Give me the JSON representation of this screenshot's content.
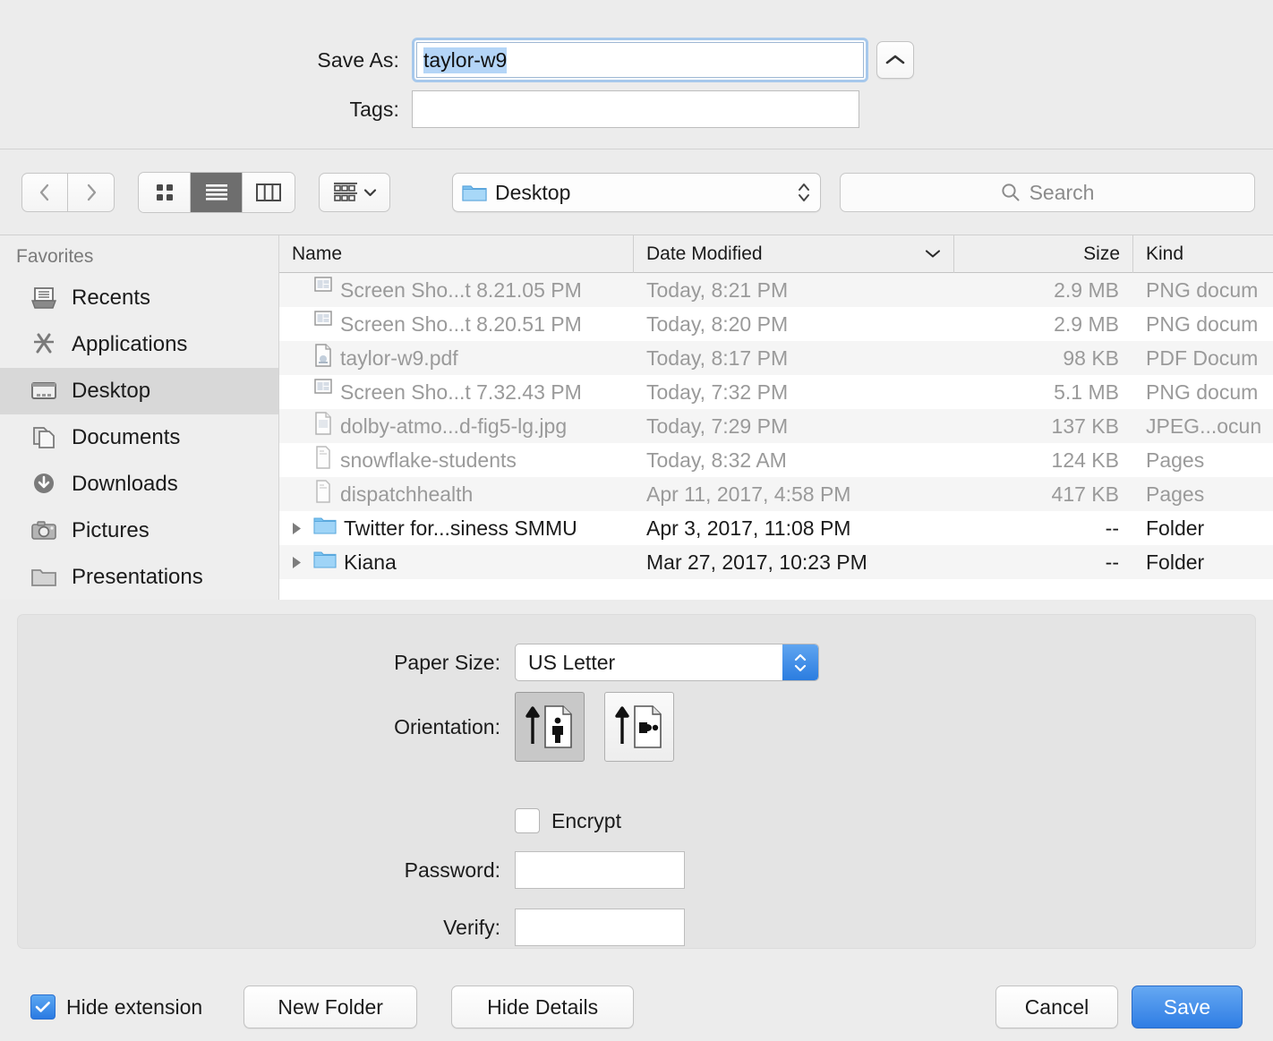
{
  "save_panel": {
    "save_as_label": "Save As:",
    "save_as_value": "taylor-w9",
    "tags_label": "Tags:",
    "tags_value": "",
    "tags_placeholder": "",
    "collapse_icon": "chevron-up-icon"
  },
  "toolbar": {
    "back_icon": "chevron-left-icon",
    "forward_icon": "chevron-right-icon",
    "view_modes": [
      {
        "name": "icon-view",
        "icon": "grid-icon",
        "selected": false
      },
      {
        "name": "list-view",
        "icon": "list-icon",
        "selected": true
      },
      {
        "name": "column-view",
        "icon": "columns-icon",
        "selected": false
      }
    ],
    "arrange_icon": "arrange-icon",
    "arrange_chevron": "chevron-down-icon",
    "path_popup": {
      "icon": "folder-icon",
      "label": "Desktop",
      "stepper_icon": "updown-chevrons-icon"
    },
    "search": {
      "icon": "search-icon",
      "placeholder": "Search",
      "value": ""
    }
  },
  "sidebar": {
    "header": "Favorites",
    "items": [
      {
        "label": "Recents",
        "icon": "recents-icon",
        "selected": false
      },
      {
        "label": "Applications",
        "icon": "applications-icon",
        "selected": false
      },
      {
        "label": "Desktop",
        "icon": "desktop-icon",
        "selected": true
      },
      {
        "label": "Documents",
        "icon": "documents-icon",
        "selected": false
      },
      {
        "label": "Downloads",
        "icon": "downloads-icon",
        "selected": false
      },
      {
        "label": "Pictures",
        "icon": "pictures-icon",
        "selected": false
      },
      {
        "label": "Presentations",
        "icon": "folder-icon",
        "selected": false
      }
    ]
  },
  "file_list": {
    "columns": [
      {
        "label": "Name",
        "sorted": false
      },
      {
        "label": "Date Modified",
        "sorted": true,
        "sort_icon": "chevron-down-icon"
      },
      {
        "label": "Size",
        "sorted": false
      },
      {
        "label": "Kind",
        "sorted": false
      }
    ],
    "rows": [
      {
        "name": "Screen Sho...t 8.21.05 PM",
        "date": "Today, 8:21 PM",
        "size": "2.9 MB",
        "kind": "PNG docum",
        "icon": "png-file-icon",
        "enabled": false,
        "expandable": false
      },
      {
        "name": "Screen Sho...t 8.20.51 PM",
        "date": "Today, 8:20 PM",
        "size": "2.9 MB",
        "kind": "PNG docum",
        "icon": "png-file-icon",
        "enabled": false,
        "expandable": false
      },
      {
        "name": "taylor-w9.pdf",
        "date": "Today, 8:17 PM",
        "size": "98 KB",
        "kind": "PDF Docum",
        "icon": "pdf-file-icon",
        "enabled": false,
        "expandable": false
      },
      {
        "name": "Screen Sho...t 7.32.43 PM",
        "date": "Today, 7:32 PM",
        "size": "5.1 MB",
        "kind": "PNG docum",
        "icon": "png-file-icon",
        "enabled": false,
        "expandable": false
      },
      {
        "name": "dolby-atmo...d-fig5-lg.jpg",
        "date": "Today, 7:29 PM",
        "size": "137 KB",
        "kind": "JPEG...ocun",
        "icon": "jpeg-file-icon",
        "enabled": false,
        "expandable": false
      },
      {
        "name": "snowflake-students",
        "date": "Today, 8:32 AM",
        "size": "124 KB",
        "kind": "Pages",
        "icon": "pages-file-icon",
        "enabled": false,
        "expandable": false
      },
      {
        "name": "dispatchhealth",
        "date": "Apr 11, 2017, 4:58 PM",
        "size": "417 KB",
        "kind": "Pages",
        "icon": "pages-file-icon",
        "enabled": false,
        "expandable": false
      },
      {
        "name": "Twitter for...siness SMMU",
        "date": "Apr 3, 2017, 11:08 PM",
        "size": "--",
        "kind": "Folder",
        "icon": "folder-icon",
        "enabled": true,
        "expandable": true
      },
      {
        "name": "Kiana",
        "date": "Mar 27, 2017, 10:23 PM",
        "size": "--",
        "kind": "Folder",
        "icon": "folder-icon",
        "enabled": true,
        "expandable": true
      }
    ]
  },
  "details": {
    "paper_size_label": "Paper Size:",
    "paper_size_value": "US Letter",
    "orientation_label": "Orientation:",
    "orientation_portrait": {
      "name": "portrait",
      "selected": true
    },
    "orientation_landscape": {
      "name": "landscape",
      "selected": false
    },
    "encrypt_label": "Encrypt",
    "encrypt_checked": false,
    "password_label": "Password:",
    "password_value": "",
    "verify_label": "Verify:",
    "verify_value": ""
  },
  "footer": {
    "hide_extension_label": "Hide extension",
    "hide_extension_checked": true,
    "new_folder_label": "New Folder",
    "hide_details_label": "Hide Details",
    "cancel_label": "Cancel",
    "save_label": "Save"
  },
  "colors": {
    "accent": "#2f7de4",
    "selection": "#b4d5f7",
    "focus_ring": "#a6c8ec",
    "window_bg": "#ececec",
    "panel_bg": "#e4e4e4",
    "row_stripe": "#f5f5f5",
    "disabled_text": "#9a9a9a"
  }
}
